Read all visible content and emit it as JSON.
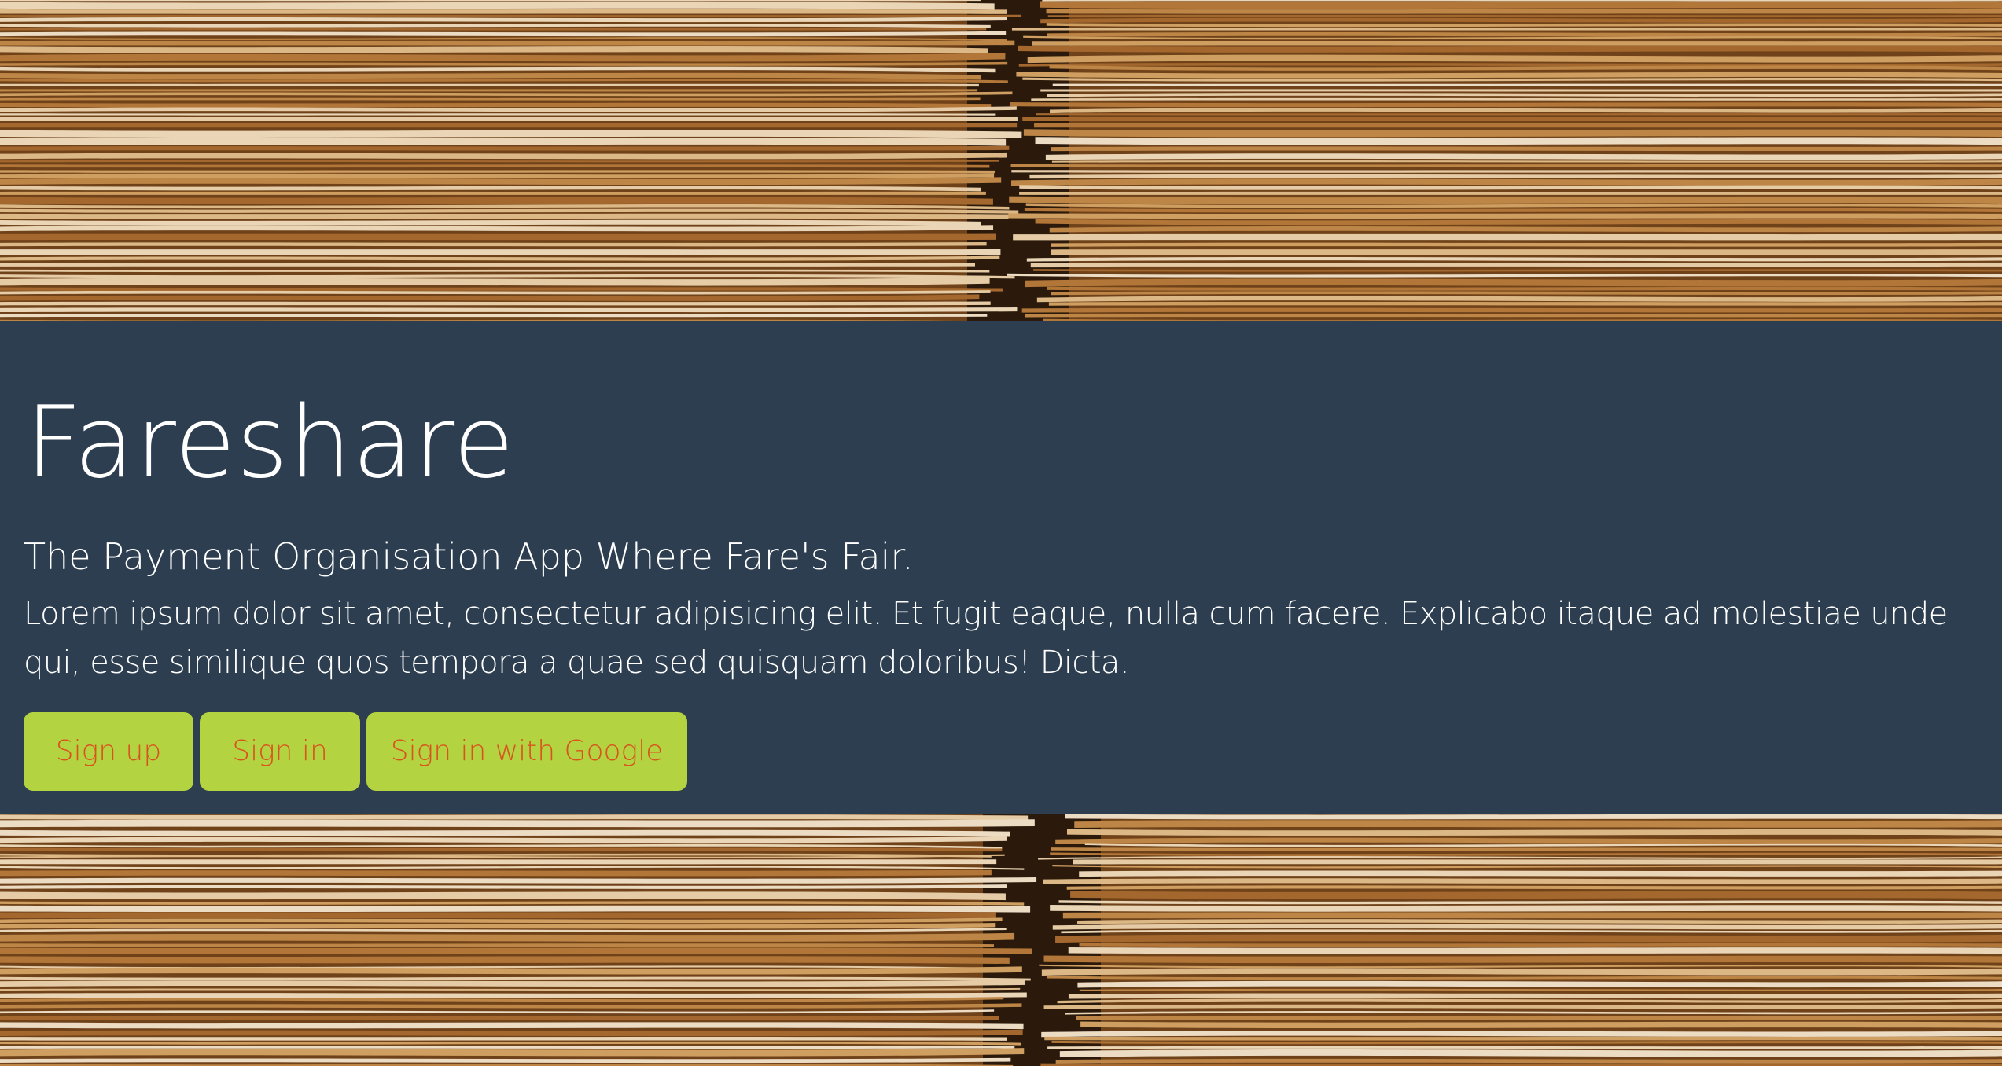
{
  "hero": {
    "title": "Fareshare",
    "subtitle": "The Payment Organisation App Where Fare's Fair.",
    "body": "Lorem ipsum dolor sit amet, consectetur adipisicing elit. Et fugit eaque, nulla cum facere. Explicabo itaque ad molestiae unde qui, esse similique quos tempora a quae sed quisquam doloribus! Dicta.",
    "buttons": {
      "signup": "Sign up",
      "signin": "Sign in",
      "google": "Sign in with Google"
    }
  },
  "colors": {
    "hero_background": "#2c3e50",
    "button_background": "#b4d340",
    "button_text": "#d9531e",
    "heading_text": "#ffffff"
  },
  "background_image": "stacked-paper-files-photo"
}
